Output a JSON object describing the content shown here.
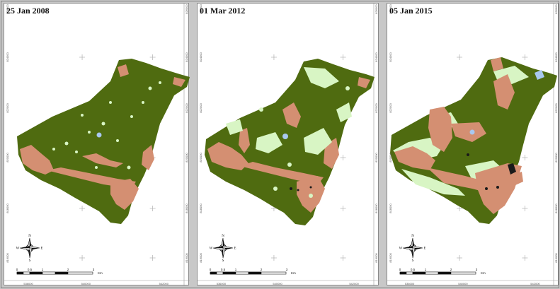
{
  "colors": {
    "forest": "#4f6b10",
    "bare": "#d48f72",
    "grass": "#d8f5c4",
    "water": "#a9c8f0",
    "dark": "#1a1a1a",
    "crosshair": "#b0b0b0"
  },
  "panels": [
    {
      "date": "25 Jan 2008",
      "x_ticks": [
        "536000",
        "540000",
        "542000"
      ]
    },
    {
      "date": "01 Mar 2012",
      "x_ticks": [
        "536000",
        "540000",
        "542000"
      ]
    },
    {
      "date": "05 Jan 2015",
      "x_ticks": [
        "536000",
        "540000",
        "542000"
      ]
    }
  ],
  "y_ticks": [
    "826000",
    "824000",
    "822000",
    "820000",
    "818000",
    "816000"
  ],
  "scale_bar": {
    "labels": [
      "0",
      "0.5",
      "1",
      "2",
      "3"
    ],
    "unit": "Km"
  },
  "north_arrow": {
    "n": "N",
    "s": "S",
    "e": "E",
    "w": "W",
    "icon": "compass-rose-icon"
  }
}
